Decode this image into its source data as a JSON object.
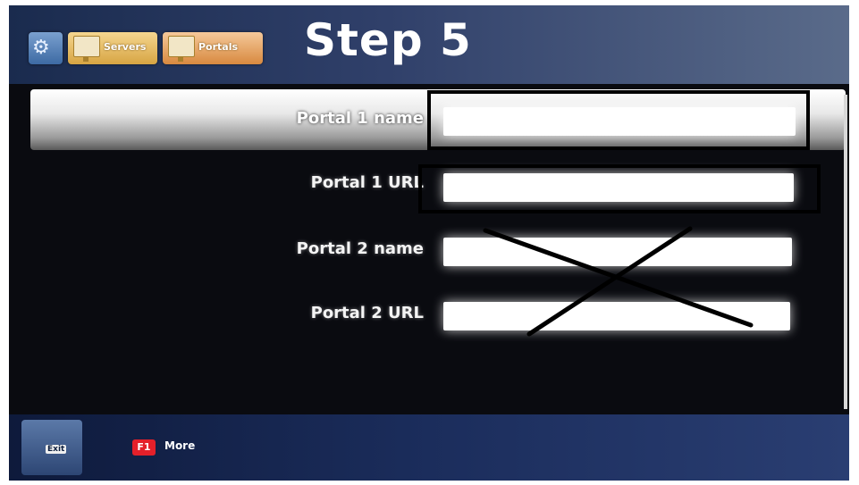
{
  "header": {
    "title": "Step 5",
    "tabs": [
      {
        "name": "settings",
        "label": "",
        "icon": "gear-icon"
      },
      {
        "name": "servers",
        "label": "Servers",
        "icon": "monitor-icon"
      },
      {
        "name": "portals",
        "label": "Portals",
        "icon": "monitor-icon"
      }
    ]
  },
  "form": {
    "fields": [
      {
        "label": "Portal 1 name",
        "value": ""
      },
      {
        "label": "Portal 1 URL",
        "value": ""
      },
      {
        "label": "Portal 2 name",
        "value": ""
      },
      {
        "label": "Portal 2 URL",
        "value": ""
      }
    ]
  },
  "footer": {
    "exit_label": "Exit",
    "f1_key": "F1",
    "more_label": "More"
  },
  "colors": {
    "highlight_row": "#e8e8e8",
    "tab_servers": "#d7a543",
    "tab_portals": "#d8893f",
    "f1_red": "#e4202a",
    "annotation": "#000000"
  }
}
